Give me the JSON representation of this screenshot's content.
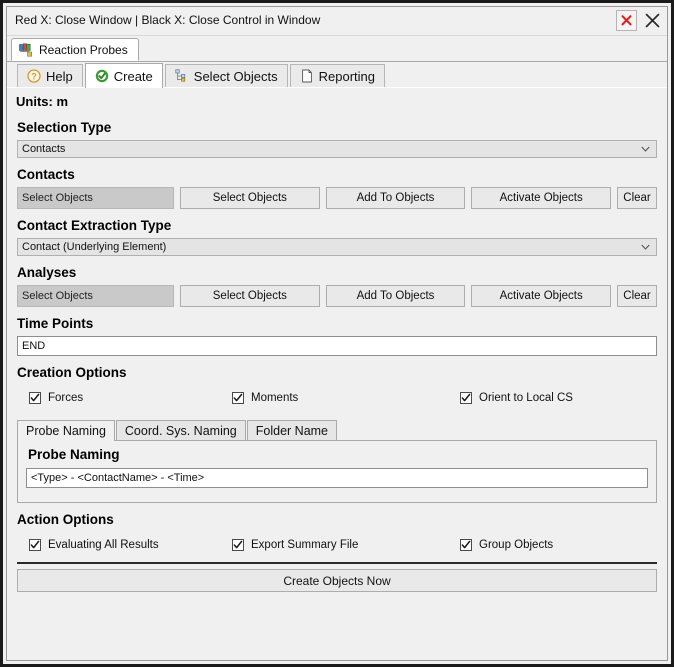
{
  "window": {
    "title": "Red X: Close Window | Black X: Close Control in Window",
    "close_window_icon": "red-x-icon",
    "close_control_icon": "black-x-icon"
  },
  "doc_tab": {
    "label": "Reaction Probes",
    "icon": "reaction-probes-icon"
  },
  "tabs": [
    {
      "label": "Help",
      "icon": "question-mark-icon",
      "active": false
    },
    {
      "label": "Create",
      "icon": "green-check-icon",
      "active": true
    },
    {
      "label": "Select Objects",
      "icon": "tree-hierarchy-icon",
      "active": false
    },
    {
      "label": "Reporting",
      "icon": "document-page-icon",
      "active": false
    }
  ],
  "units": "Units: m",
  "selection_type": {
    "heading": "Selection Type",
    "value": "Contacts"
  },
  "contacts": {
    "heading": "Contacts",
    "field_value": "Select Objects",
    "buttons": [
      "Select Objects",
      "Add To Objects",
      "Activate Objects",
      "Clear"
    ]
  },
  "contact_extraction_type": {
    "heading": "Contact Extraction Type",
    "value": "Contact (Underlying Element)"
  },
  "analyses": {
    "heading": "Analyses",
    "field_value": "Select Objects",
    "buttons": [
      "Select Objects",
      "Add To Objects",
      "Activate Objects",
      "Clear"
    ]
  },
  "time_points": {
    "heading": "Time Points",
    "value": "END"
  },
  "creation_options": {
    "heading": "Creation Options",
    "checkboxes": [
      {
        "label": "Forces",
        "checked": true
      },
      {
        "label": "Moments",
        "checked": true
      },
      {
        "label": "Orient to Local CS",
        "checked": true
      }
    ]
  },
  "naming": {
    "tabs": [
      {
        "label": "Probe Naming",
        "active": true
      },
      {
        "label": "Coord. Sys. Naming",
        "active": false
      },
      {
        "label": "Folder Name",
        "active": false
      }
    ],
    "panel_heading": "Probe Naming",
    "pattern_value": "<Type> - <ContactName> - <Time>"
  },
  "action_options": {
    "heading": "Action Options",
    "checkboxes": [
      {
        "label": "Evaluating All Results",
        "checked": true
      },
      {
        "label": "Export Summary File",
        "checked": true
      },
      {
        "label": "Group Objects",
        "checked": true
      }
    ]
  },
  "create_button": {
    "label": "Create Objects Now"
  },
  "colors": {
    "window_border": "#1a1a1a",
    "panel_bg": "#f0f0f0",
    "red_x": "#e02020",
    "green_check": "#3a9a35",
    "help_orange": "#e8a33d",
    "readonly_field": "#c9c9c9"
  }
}
